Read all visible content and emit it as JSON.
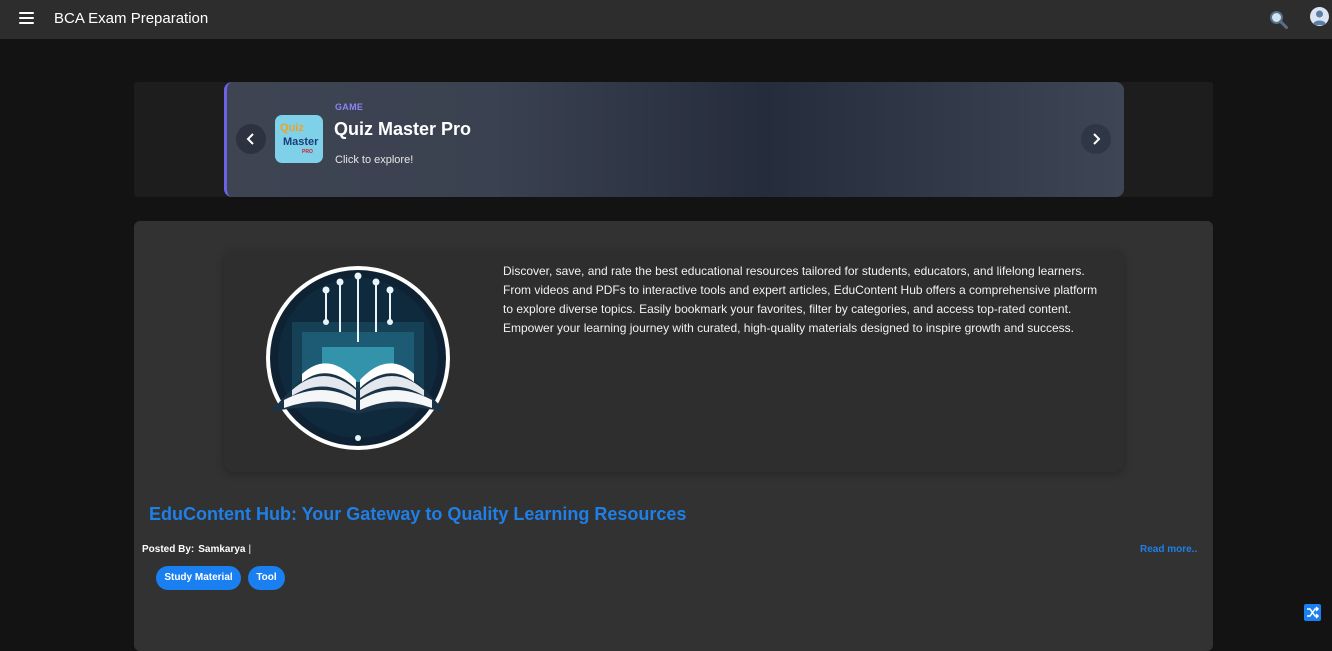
{
  "header": {
    "title": "BCA Exam Preparation",
    "menu_icon": "hamburger-menu-icon",
    "search_icon": "search-icon",
    "avatar_icon": "user-avatar-icon"
  },
  "promo": {
    "category": "GAME",
    "title": "Quiz Master Pro",
    "subtitle": "Click to explore!",
    "app_icon_text": [
      "Quiz",
      "Master",
      "PRO"
    ],
    "accent_color": "#6b63e6"
  },
  "post": {
    "description": "Discover, save, and rate the best educational resources tailored for students, educators, and lifelong learners. From videos and PDFs to interactive tools and expert articles, EduContent Hub offers a comprehensive platform to explore diverse topics. Easily bookmark your favorites, filter by categories, and access top-rated content. Empower your learning journey with curated, high-quality materials designed to inspire growth and success.",
    "title": "EduContent Hub: Your Gateway to Quality Learning Resources",
    "posted_by_label": "Posted By:",
    "author": "Samkarya",
    "separator": "|",
    "read_more": "Read more..",
    "tags": [
      "Study Material",
      "Tool"
    ]
  },
  "colors": {
    "link_blue": "#1f7fe6",
    "tag_blue": "#1a7ff0",
    "background": "#131313",
    "topbar": "#2d2d2d"
  }
}
